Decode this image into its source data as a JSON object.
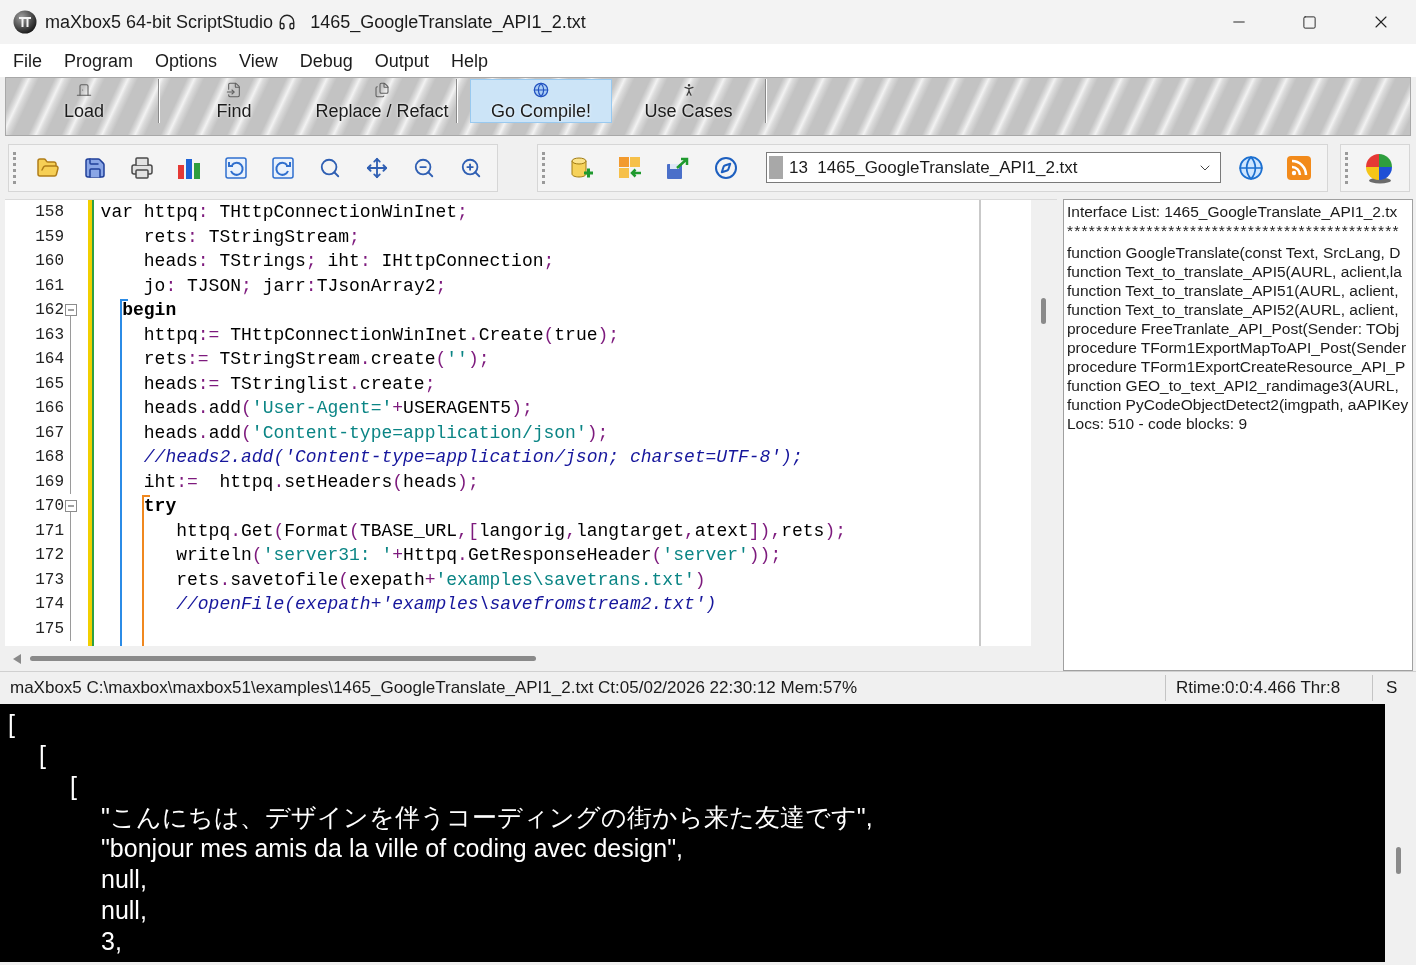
{
  "window": {
    "app_title": "maXbox5 64-bit ScriptStudio",
    "document_title": "1465_GoogleTranslate_API1_2.txt"
  },
  "menu": [
    "File",
    "Program",
    "Options",
    "View",
    "Debug",
    "Output",
    "Help"
  ],
  "command_bar": {
    "groups": [
      {
        "buttons": [
          {
            "label": "Load",
            "highlighted": false
          }
        ]
      },
      {
        "buttons": [
          {
            "label": "Find",
            "highlighted": false
          },
          {
            "label": "Replace / Refact",
            "highlighted": false
          }
        ]
      },
      {
        "buttons": [
          {
            "label": "Go Compile!",
            "highlighted": true
          },
          {
            "label": "Use Cases",
            "highlighted": false
          }
        ]
      }
    ]
  },
  "file_selector": {
    "value": "13  1465_GoogleTranslate_API1_2.txt"
  },
  "editor": {
    "lines": [
      {
        "number": "158",
        "segments": [
          {
            "kind": "plain",
            "text": "var httpq"
          },
          {
            "kind": "symbol",
            "text": ":"
          },
          {
            "kind": "plain",
            "text": " THttpConnectionWinInet"
          },
          {
            "kind": "symbol",
            "text": ";"
          }
        ]
      },
      {
        "number": "159",
        "segments": [
          {
            "kind": "plain",
            "text": "    rets"
          },
          {
            "kind": "symbol",
            "text": ":"
          },
          {
            "kind": "plain",
            "text": " TStringStream"
          },
          {
            "kind": "symbol",
            "text": ";"
          }
        ]
      },
      {
        "number": "160",
        "segments": [
          {
            "kind": "plain",
            "text": "    heads"
          },
          {
            "kind": "symbol",
            "text": ":"
          },
          {
            "kind": "plain",
            "text": " TStrings"
          },
          {
            "kind": "symbol",
            "text": ";"
          },
          {
            "kind": "plain",
            "text": " iht"
          },
          {
            "kind": "symbol",
            "text": ":"
          },
          {
            "kind": "plain",
            "text": " IHttpConnection"
          },
          {
            "kind": "symbol",
            "text": ";"
          }
        ]
      },
      {
        "number": "161",
        "segments": [
          {
            "kind": "plain",
            "text": "    jo"
          },
          {
            "kind": "symbol",
            "text": ":"
          },
          {
            "kind": "plain",
            "text": " TJSON"
          },
          {
            "kind": "symbol",
            "text": ";"
          },
          {
            "kind": "plain",
            "text": " jarr"
          },
          {
            "kind": "symbol",
            "text": ":"
          },
          {
            "kind": "plain",
            "text": "TJsonArray2"
          },
          {
            "kind": "symbol",
            "text": ";"
          }
        ]
      },
      {
        "number": "162",
        "fold": {
          "expanded": true
        },
        "guide": {
          "color": "#2b8be6"
        },
        "segments": [
          {
            "kind": "keyword",
            "text": "  begin"
          }
        ]
      },
      {
        "number": "163",
        "segments": [
          {
            "kind": "plain",
            "text": "    httpq"
          },
          {
            "kind": "symbol",
            "text": ":="
          },
          {
            "kind": "plain",
            "text": " THttpConnectionWinInet"
          },
          {
            "kind": "symbol",
            "text": "."
          },
          {
            "kind": "plain",
            "text": "Create"
          },
          {
            "kind": "symbol",
            "text": "("
          },
          {
            "kind": "plain",
            "text": "true"
          },
          {
            "kind": "symbol",
            "text": ");"
          }
        ]
      },
      {
        "number": "164",
        "segments": [
          {
            "kind": "plain",
            "text": "    rets"
          },
          {
            "kind": "symbol",
            "text": ":="
          },
          {
            "kind": "plain",
            "text": " TStringStream"
          },
          {
            "kind": "symbol",
            "text": "."
          },
          {
            "kind": "plain",
            "text": "create"
          },
          {
            "kind": "symbol",
            "text": "("
          },
          {
            "kind": "string",
            "text": "''"
          },
          {
            "kind": "symbol",
            "text": ");"
          }
        ]
      },
      {
        "number": "165",
        "segments": [
          {
            "kind": "plain",
            "text": "    heads"
          },
          {
            "kind": "symbol",
            "text": ":="
          },
          {
            "kind": "plain",
            "text": " TStringlist"
          },
          {
            "kind": "symbol",
            "text": "."
          },
          {
            "kind": "plain",
            "text": "create"
          },
          {
            "kind": "symbol",
            "text": ";"
          }
        ]
      },
      {
        "number": "166",
        "segments": [
          {
            "kind": "plain",
            "text": "    heads"
          },
          {
            "kind": "symbol",
            "text": "."
          },
          {
            "kind": "plain",
            "text": "add"
          },
          {
            "kind": "symbol",
            "text": "("
          },
          {
            "kind": "string",
            "text": "'User-Agent='"
          },
          {
            "kind": "symbol",
            "text": "+"
          },
          {
            "kind": "plain",
            "text": "USERAGENT5"
          },
          {
            "kind": "symbol",
            "text": ");"
          }
        ]
      },
      {
        "number": "167",
        "segments": [
          {
            "kind": "plain",
            "text": "    heads"
          },
          {
            "kind": "symbol",
            "text": "."
          },
          {
            "kind": "plain",
            "text": "add"
          },
          {
            "kind": "symbol",
            "text": "("
          },
          {
            "kind": "string",
            "text": "'Content-type=application/json'"
          },
          {
            "kind": "symbol",
            "text": ");"
          }
        ]
      },
      {
        "number": "168",
        "segments": [
          {
            "kind": "comment",
            "text": "    //heads2.add('Content-type=application/json; charset=UTF-8');"
          }
        ]
      },
      {
        "number": "169",
        "segments": [
          {
            "kind": "plain",
            "text": "    iht"
          },
          {
            "kind": "symbol",
            "text": ":="
          },
          {
            "kind": "plain",
            "text": "  httpq"
          },
          {
            "kind": "symbol",
            "text": "."
          },
          {
            "kind": "plain",
            "text": "setHeaders"
          },
          {
            "kind": "symbol",
            "text": "("
          },
          {
            "kind": "plain",
            "text": "heads"
          },
          {
            "kind": "symbol",
            "text": ");"
          }
        ]
      },
      {
        "number": "170",
        "fold": {
          "expanded": true
        },
        "guide": {
          "color": "#f0881f"
        },
        "segments": [
          {
            "kind": "keyword",
            "text": "    try"
          }
        ]
      },
      {
        "number": "171",
        "segments": [
          {
            "kind": "plain",
            "text": "       httpq"
          },
          {
            "kind": "symbol",
            "text": "."
          },
          {
            "kind": "plain",
            "text": "Get"
          },
          {
            "kind": "symbol",
            "text": "("
          },
          {
            "kind": "plain",
            "text": "Format"
          },
          {
            "kind": "symbol",
            "text": "("
          },
          {
            "kind": "plain",
            "text": "TBASE_URL"
          },
          {
            "kind": "symbol",
            "text": ",["
          },
          {
            "kind": "plain",
            "text": "langorig"
          },
          {
            "kind": "symbol",
            "text": ","
          },
          {
            "kind": "plain",
            "text": "langtarget"
          },
          {
            "kind": "symbol",
            "text": ","
          },
          {
            "kind": "plain",
            "text": "atext"
          },
          {
            "kind": "symbol",
            "text": "]),"
          },
          {
            "kind": "plain",
            "text": "rets"
          },
          {
            "kind": "symbol",
            "text": ");"
          }
        ]
      },
      {
        "number": "172",
        "segments": [
          {
            "kind": "plain",
            "text": "       writeln"
          },
          {
            "kind": "symbol",
            "text": "("
          },
          {
            "kind": "string",
            "text": "'server31: '"
          },
          {
            "kind": "symbol",
            "text": "+"
          },
          {
            "kind": "plain",
            "text": "Httpq"
          },
          {
            "kind": "symbol",
            "text": "."
          },
          {
            "kind": "plain",
            "text": "GetResponseHeader"
          },
          {
            "kind": "symbol",
            "text": "("
          },
          {
            "kind": "string",
            "text": "'server'"
          },
          {
            "kind": "symbol",
            "text": "));"
          }
        ]
      },
      {
        "number": "173",
        "segments": [
          {
            "kind": "plain",
            "text": "       rets"
          },
          {
            "kind": "symbol",
            "text": "."
          },
          {
            "kind": "plain",
            "text": "savetofile"
          },
          {
            "kind": "symbol",
            "text": "("
          },
          {
            "kind": "plain",
            "text": "exepath"
          },
          {
            "kind": "symbol",
            "text": "+"
          },
          {
            "kind": "string",
            "text": "'examples\\savetrans.txt'"
          },
          {
            "kind": "symbol",
            "text": ")"
          }
        ]
      },
      {
        "number": "174",
        "segments": [
          {
            "kind": "comment",
            "text": "       //openFile(exepath+'examples\\savefromstream2.txt')"
          }
        ]
      },
      {
        "number": "175"
      }
    ]
  },
  "interface_list": {
    "title": "Interface List: 1465_GoogleTranslate_API1_2.tx",
    "separator": "**********************************************",
    "entries": [
      "function GoogleTranslate(const Text, SrcLang, D",
      "function Text_to_translate_API5(AURL, aclient,la",
      "function Text_to_translate_API51(AURL, aclient,",
      "function Text_to_translate_API52(AURL, aclient,",
      "procedure FreeTranlate_API_Post(Sender: TObj",
      "procedure TForm1ExportMapToAPI_Post(Sender",
      "procedure TForm1ExportCreateResource_API_P",
      "function GEO_to_text_API2_randimage3(AURL,",
      "function PyCodeObjectDetect2(imgpath, aAPIKey"
    ],
    "summary": "Locs: 510 - code blocks: 9"
  },
  "status_bar": {
    "file_info": "maXbox5 C:\\maxbox\\maxbox51\\examples\\1465_GoogleTranslate_API1_2.txt Ct:05/02/2026 22:30:12 Mem:57%",
    "runtime": "Rtime:0:0:4.466 Thr:8",
    "section_3": "S"
  },
  "console": {
    "lines": [
      {
        "text": "[",
        "children": [
          {
            "text": "[",
            "children": [
              {
                "text": "[",
                "children": [
                  {
                    "text": "\"こんにちは、デザインを伴うコーディングの街から来た友達です\","
                  },
                  {
                    "text": "\"bonjour mes amis da la ville of coding avec design\","
                  },
                  {
                    "text": "null,"
                  },
                  {
                    "text": "null,"
                  },
                  {
                    "text": "3,"
                  }
                ]
              }
            ]
          }
        ]
      }
    ]
  }
}
